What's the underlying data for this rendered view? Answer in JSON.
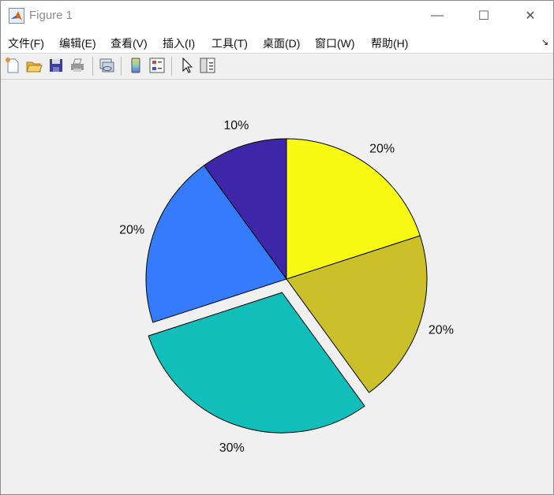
{
  "window": {
    "title": "Figure 1",
    "minimize": "—",
    "maximize": "☐",
    "close": "✕"
  },
  "menu": [
    "文件(F)",
    "编辑(E)",
    "查看(V)",
    "插入(I)",
    "工具(T)",
    "桌面(D)",
    "窗口(W)",
    "帮助(H)"
  ],
  "menu_dock_icon": "↘",
  "toolbar": [
    "new-figure-icon",
    "open-file-icon",
    "save-icon",
    "print-icon",
    "link-plot-icon",
    "colorbar-icon",
    "legend-icon",
    "pointer-icon",
    "property-editor-icon"
  ],
  "chart_data": {
    "type": "pie",
    "values": [
      1,
      2,
      3,
      2,
      2
    ],
    "labels": [
      "10%",
      "20%",
      "30%",
      "20%",
      "20%"
    ],
    "explode": [
      false,
      false,
      true,
      false,
      false
    ],
    "colors": [
      "#3e26a8",
      "#347bfd",
      "#12beb9",
      "#cbc029",
      "#f9fa14"
    ],
    "start_angle_deg": 90,
    "direction": "counterclockwise"
  }
}
